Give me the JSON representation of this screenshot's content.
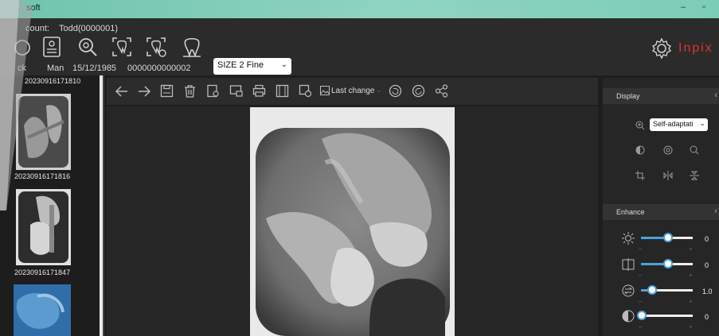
{
  "titlebar": {
    "title": "soft",
    "min_label": "–",
    "max_label": "▫"
  },
  "header": {
    "account_label": "count:",
    "account_value": "Todd(0000001)",
    "patient_name": "ck",
    "gender": "Man",
    "birthdate": "15/12/1985",
    "patient_id": "0000000000002",
    "size_select": {
      "value": "SIZE 2 Fine"
    },
    "brand": "Inpix",
    "tool_icons": [
      "back-icon",
      "patient-card-icon",
      "search-icon",
      "scan-tooth-icon",
      "scan-tooth-settings-icon",
      "tooth-icon"
    ]
  },
  "thumbnails": [
    {
      "label": "20230916171810"
    },
    {
      "label": "20230916171816"
    },
    {
      "label": "20230916171847"
    }
  ],
  "toolbar": {
    "last_change_label": "Last change",
    "icons": [
      "back-arrow-icon",
      "forward-arrow-icon",
      "save-icon",
      "delete-icon",
      "export-icon",
      "import-icon",
      "print-icon",
      "layout-icon",
      "image-edit-icon",
      "image-icon",
      "rotate-left-icon",
      "rotate-right-icon",
      "share-icon"
    ]
  },
  "display_panel": {
    "title": "Display",
    "fit_select": {
      "value": "Self-adaptati"
    }
  },
  "enhance_panel": {
    "title": "Enhance",
    "sliders": [
      {
        "name": "brightness",
        "value": "0",
        "level": 0.5,
        "minus": "–",
        "plus": "+"
      },
      {
        "name": "contrast",
        "value": "0",
        "level": 0.5,
        "minus": "–",
        "plus": "+"
      },
      {
        "name": "gamma",
        "value": "1.0",
        "level": 0.2,
        "minus": "–",
        "plus": "+"
      },
      {
        "name": "sharpen",
        "value": "0",
        "level": 0.0,
        "minus": "–",
        "plus": "+"
      }
    ]
  },
  "colors": {
    "accent": "#4aa3df",
    "brand": "#dd3333",
    "titlebar": "#7ccdb8"
  }
}
